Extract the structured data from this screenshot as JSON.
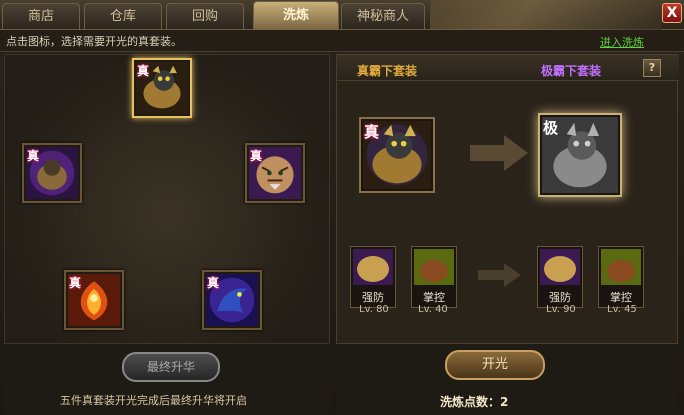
{
  "tabs": [
    {
      "label": "商店",
      "active": false
    },
    {
      "label": "仓库",
      "active": false
    },
    {
      "label": "回购",
      "active": false
    },
    {
      "label": "洗炼",
      "active": true
    },
    {
      "label": "神秘商人",
      "active": false
    }
  ],
  "close_label": "X",
  "hint": "点击图标，选择需要开光的真套装。",
  "enter_link": "进入洗炼",
  "left_panel": {
    "slots": [
      {
        "tag": "真",
        "icon": "golden-beast-icon",
        "selected": true
      },
      {
        "tag": "真",
        "icon": "purple-beast-icon",
        "selected": false
      },
      {
        "tag": "真",
        "icon": "tiger-icon",
        "selected": false
      },
      {
        "tag": "真",
        "icon": "phoenix-icon",
        "selected": false
      },
      {
        "tag": "真",
        "icon": "blue-dragon-icon",
        "selected": false
      }
    ],
    "final_button": "最终升华",
    "footer": "五件真套装开光完成后最终升华将开启"
  },
  "right_panel": {
    "title_left": "真霸下套装",
    "title_right": "极霸下套装",
    "help": "?",
    "source_item": {
      "tag": "真",
      "icon": "golden-beast-icon"
    },
    "target_item": {
      "tag": "极",
      "icon": "grey-beast-icon"
    },
    "skills_before": [
      {
        "label": "强防",
        "level": "Lv. 80",
        "icon": "purple-shell-icon"
      },
      {
        "label": "掌控",
        "level": "Lv. 40",
        "icon": "green-turtle-icon"
      }
    ],
    "skills_after": [
      {
        "label": "强防",
        "level": "Lv. 90",
        "icon": "purple-shell-icon"
      },
      {
        "label": "掌控",
        "level": "Lv. 45",
        "icon": "green-turtle-icon"
      }
    ],
    "open_button": "开光",
    "points_label": "洗炼点数：",
    "points_value": "2"
  }
}
